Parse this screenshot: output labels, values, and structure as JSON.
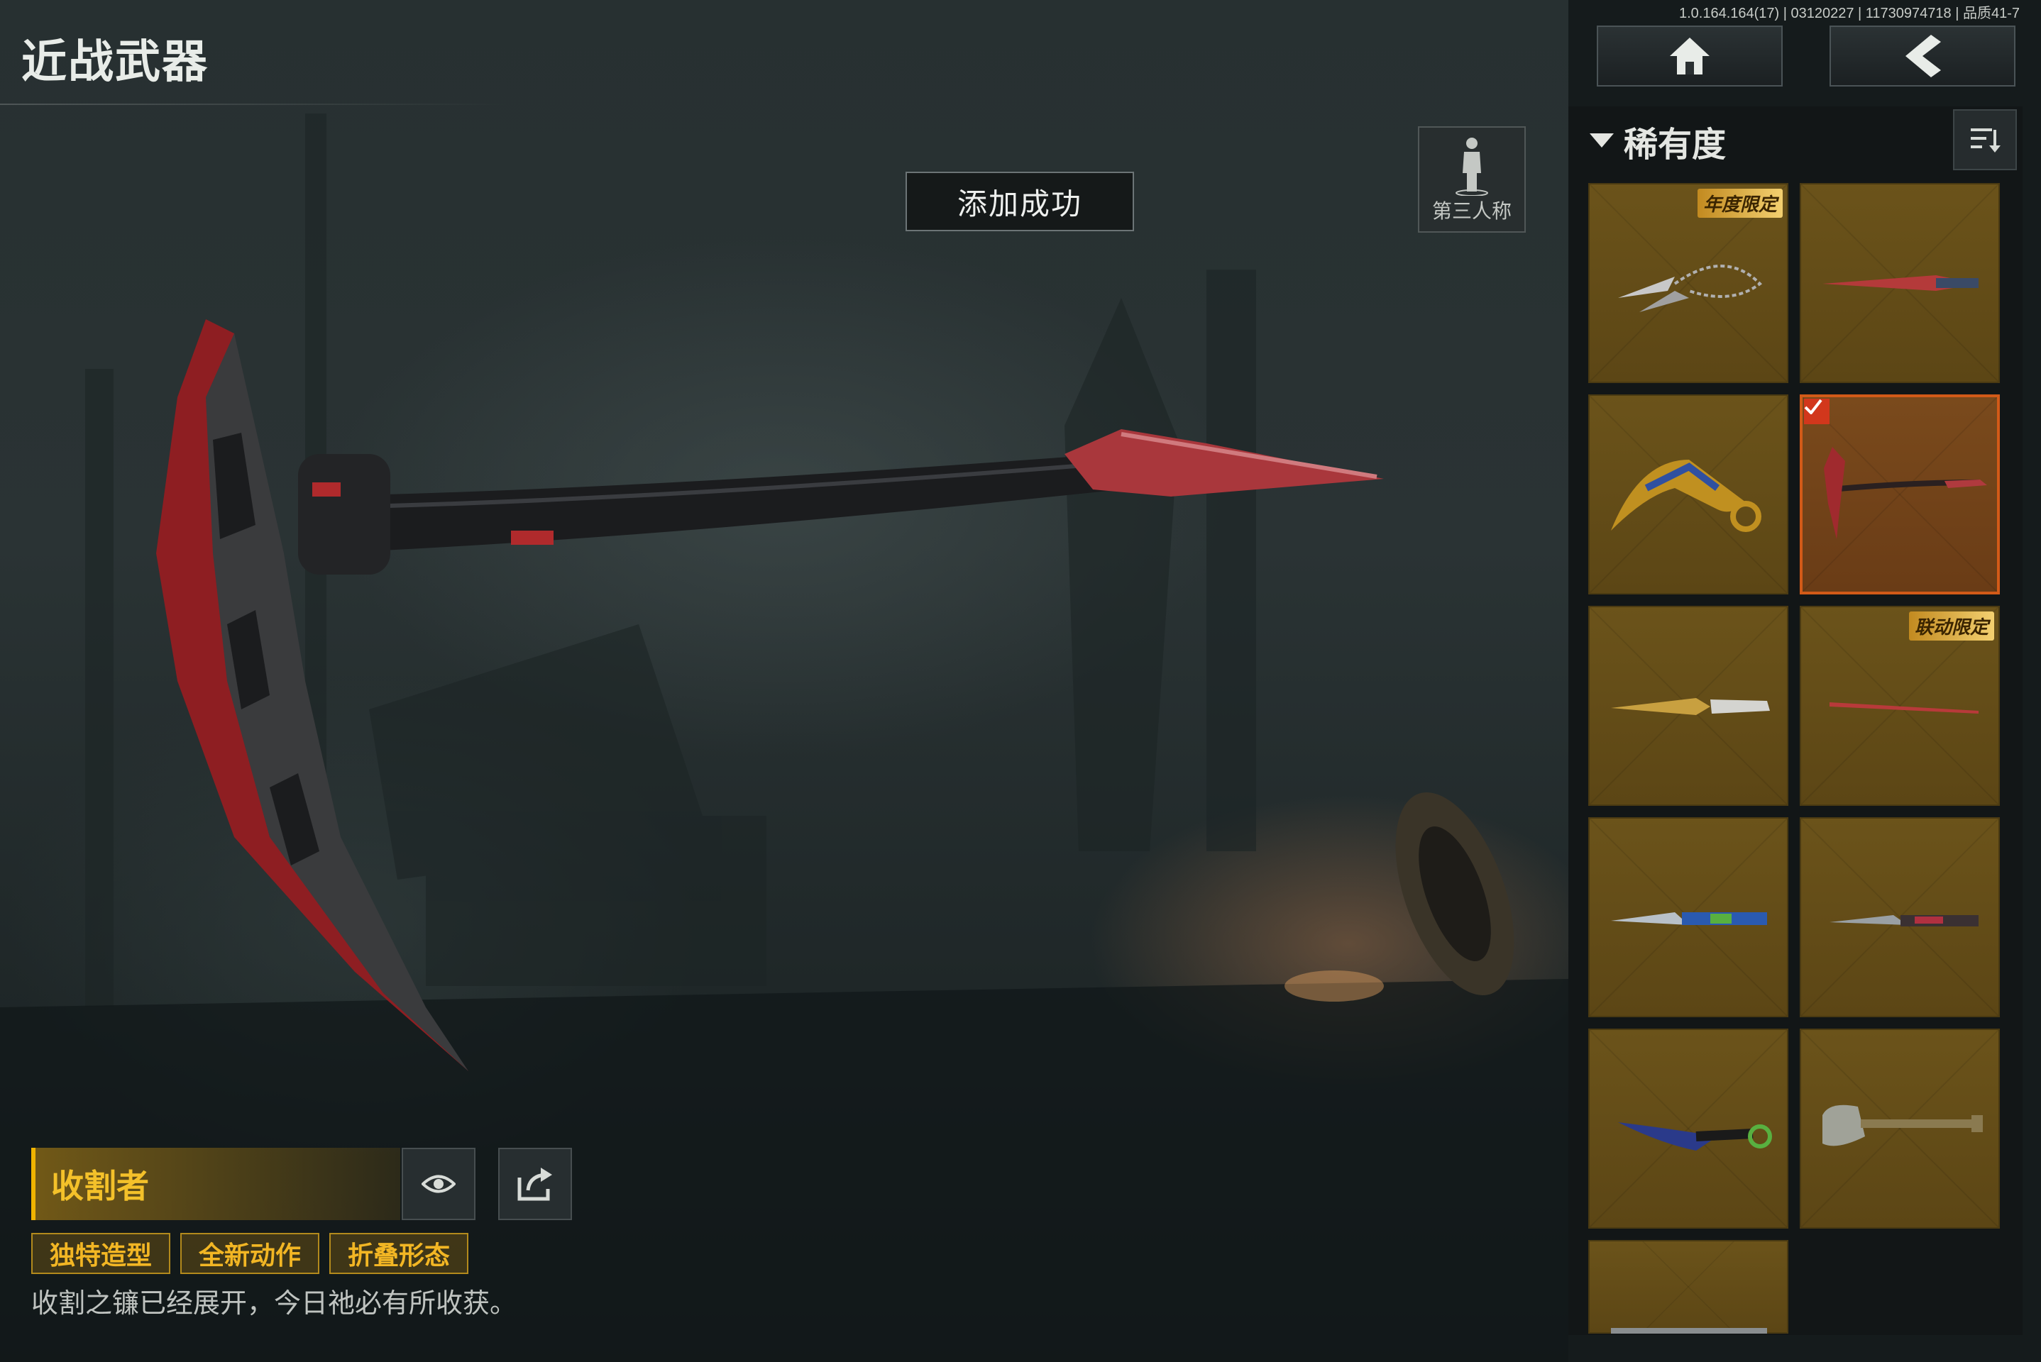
{
  "header": {
    "title": "近战武器",
    "version": "1.0.164.164(17) | 03120227 | 11730974718 | 品质41-7"
  },
  "toast": "添加成功",
  "view_toggle": {
    "label": "第三人称",
    "icon": "person-icon"
  },
  "weapon": {
    "name": "收割者",
    "tags": [
      "独特造型",
      "全新动作",
      "折叠形态"
    ],
    "description": "收割之镰已经展开，今日祂必有所收获。"
  },
  "panel": {
    "filter_label": "稀有度",
    "sort_icon": "sort-icon",
    "items": [
      {
        "badge": "年度限定",
        "icon": "chain-knife-icon",
        "selected": false
      },
      {
        "badge": "",
        "icon": "red-blade-icon",
        "selected": false
      },
      {
        "badge": "",
        "icon": "karambit-icon",
        "selected": false
      },
      {
        "badge": "",
        "icon": "scythe-icon",
        "selected": true
      },
      {
        "badge": "",
        "icon": "gold-knife-icon",
        "selected": false
      },
      {
        "badge": "联动限定",
        "icon": "red-katana-icon",
        "selected": false
      },
      {
        "badge": "",
        "icon": "blue-knife-icon",
        "selected": false
      },
      {
        "badge": "",
        "icon": "dark-dagger-icon",
        "selected": false
      },
      {
        "badge": "",
        "icon": "dark-karambit-icon",
        "selected": false
      },
      {
        "badge": "",
        "icon": "shovel-icon",
        "selected": false
      },
      {
        "badge": "",
        "icon": "blade-icon",
        "selected": false
      }
    ]
  },
  "colors": {
    "accent": "#f0b400",
    "selected_border": "#d25a18",
    "card": "#6b531a"
  }
}
